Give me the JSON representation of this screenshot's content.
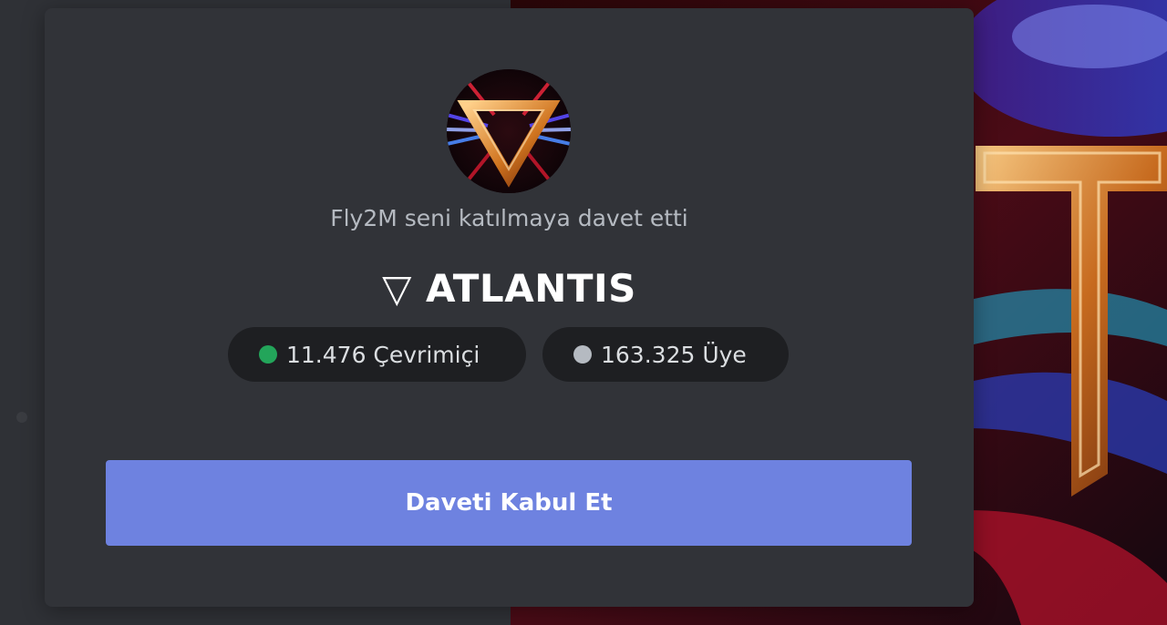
{
  "invite": {
    "inviter_text": "Fly2M seni katılmaya davet etti",
    "server_name": "▽ ATLANTIS",
    "online": {
      "text": "11.476 Çevrimiçi",
      "dot_color": "#23a55a"
    },
    "members": {
      "text": "163.325 Üye",
      "dot_color": "#b5bac1"
    },
    "accept_button_label": "Daveti Kabul Et",
    "avatar_icon": "server-logo-inverted-triangle",
    "colors": {
      "card_background": "#313338",
      "button_accent": "#6e82e0",
      "pill_background": "#1e1f22"
    }
  }
}
